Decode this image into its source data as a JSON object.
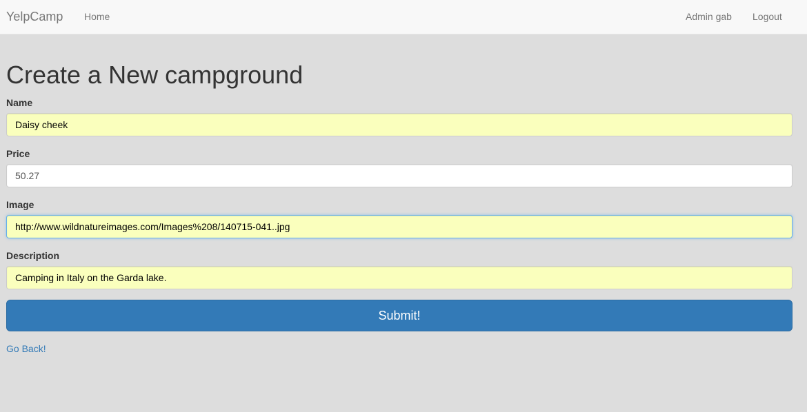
{
  "navbar": {
    "brand": "YelpCamp",
    "home_label": "Home",
    "user_label": "Admin gab",
    "logout_label": "Logout"
  },
  "page": {
    "title": "Create a New campground"
  },
  "form": {
    "name": {
      "label": "Name",
      "value": "Daisy cheek"
    },
    "price": {
      "label": "Price",
      "value": "50.27"
    },
    "image": {
      "label": "Image",
      "value": "http://www.wildnatureimages.com/Images%208/140715-041..jpg"
    },
    "description": {
      "label": "Description",
      "value": "Camping in Italy on the Garda lake."
    },
    "submit_label": "Submit!"
  },
  "back_link": "Go Back!",
  "colors": {
    "brand_primary": "#337ab7",
    "autofill_bg": "#faffbd",
    "page_bg": "#dddddd",
    "navbar_bg": "#f8f8f8"
  }
}
